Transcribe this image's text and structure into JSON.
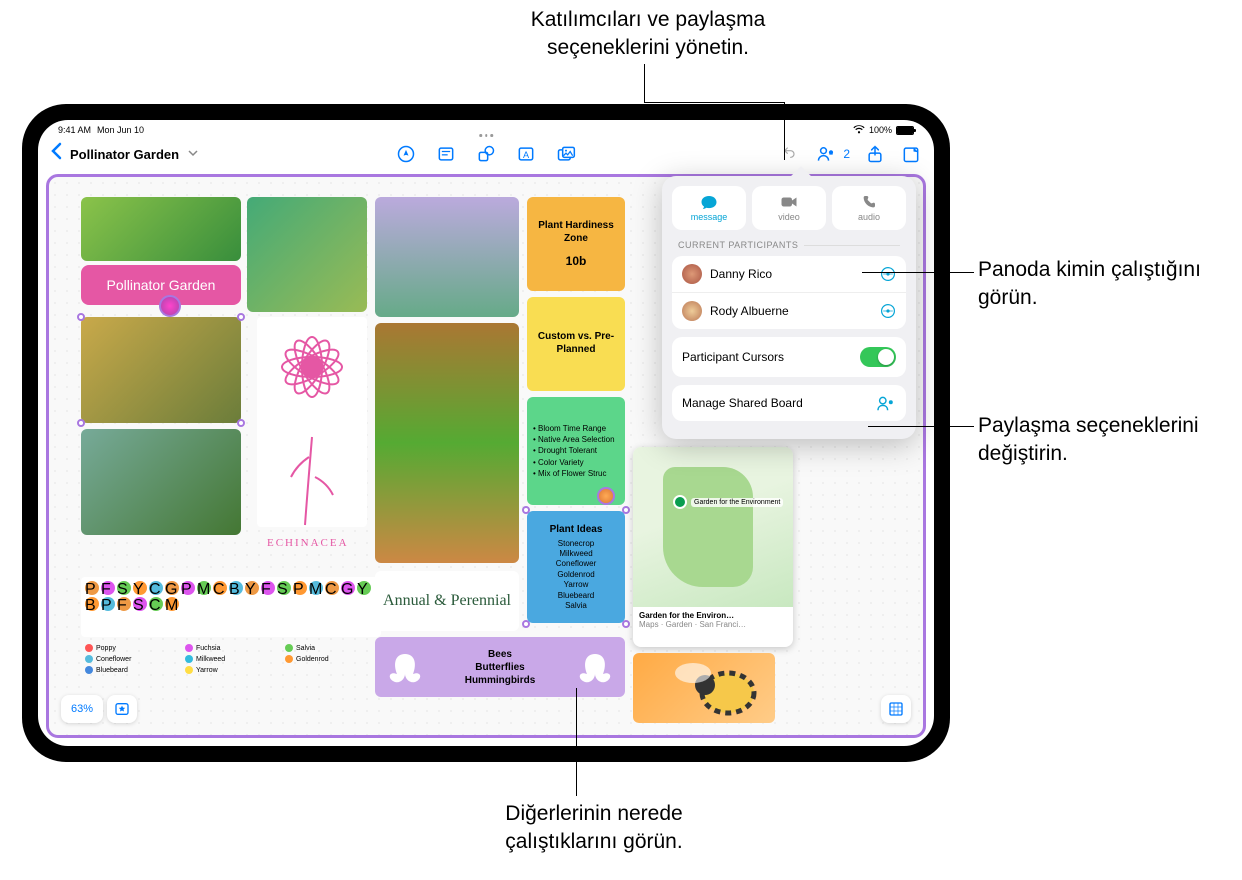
{
  "callouts": {
    "top": "Katılımcıları ve paylaşma seçeneklerini yönetin.",
    "right1": "Panoda kimin çalıştığını görün.",
    "right2": "Paylaşma seçeneklerini değiştirin.",
    "bottom": "Diğerlerinin nerede çalıştıklarını görün."
  },
  "status": {
    "time": "9:41 AM",
    "date": "Mon Jun 10",
    "battery": "100%"
  },
  "board": {
    "title": "Pollinator Garden",
    "title_card": "Pollinator Garden",
    "zoom": "63%",
    "collab_count": "2",
    "echinacea": "ECHINACEA",
    "hardiness": {
      "title": "Plant Hardiness Zone",
      "value": "10b"
    },
    "custom": "Custom vs. Pre-Planned",
    "bloom_list": {
      "title": "",
      "items": [
        "Bloom Time Range",
        "Native Area Selection",
        "Drought Tolerant",
        "Color Variety",
        "Mix of Flower Struc"
      ]
    },
    "plant_ideas": {
      "title": "Plant Ideas",
      "items": [
        "Stonecrop",
        "Milkweed",
        "Coneflower",
        "Goldenrod",
        "Yarrow",
        "Bluebeard",
        "Salvia"
      ]
    },
    "annual": "Annual & Perennial",
    "bees": "Bees\nButterflies\nHummingbirds",
    "map": {
      "label": "Garden for the Environment",
      "sub": "Garden for the Environ…",
      "meta": "Maps · Garden · San Franci…"
    },
    "legend": [
      "Poppy",
      "Fuchsia",
      "Salvia",
      "Coneflower",
      "Milkweed",
      "Goldenrod",
      "Bluebeard",
      "Yarrow"
    ]
  },
  "popover": {
    "btns": {
      "message": "message",
      "video": "video",
      "audio": "audio"
    },
    "section": "CURRENT PARTICIPANTS",
    "participants": [
      "Danny Rico",
      "Rody Albuerne"
    ],
    "cursors": "Participant Cursors",
    "manage": "Manage Shared Board"
  }
}
